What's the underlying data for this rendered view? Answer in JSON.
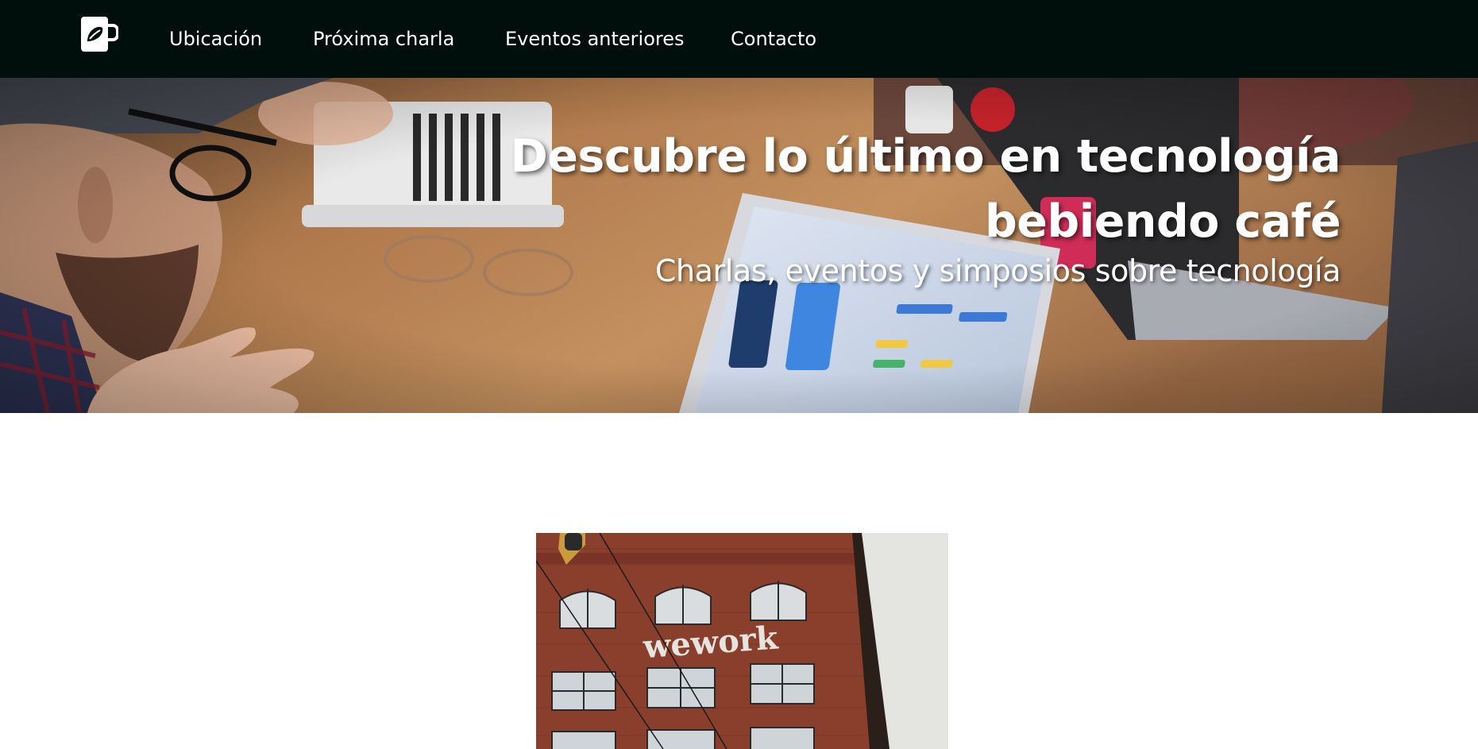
{
  "nav": {
    "logo_icon": "coffee-mug-leaf-icon",
    "items": [
      {
        "label": "Ubicación"
      },
      {
        "label": "Próxima charla"
      },
      {
        "label": "Eventos anteriores"
      },
      {
        "label": "Contacto"
      }
    ]
  },
  "hero": {
    "title_line1": "Descubre lo último en tecnología",
    "title_line2": "bebiendo café",
    "subtitle": "Charlas, eventos y simposios sobre tecnología"
  },
  "venue": {
    "sign_text": "wework"
  },
  "colors": {
    "navbar_bg": "#000f0b",
    "hero_text": "#ffffff",
    "page_bg": "#ffffff",
    "brick": "#8e3f2e"
  }
}
